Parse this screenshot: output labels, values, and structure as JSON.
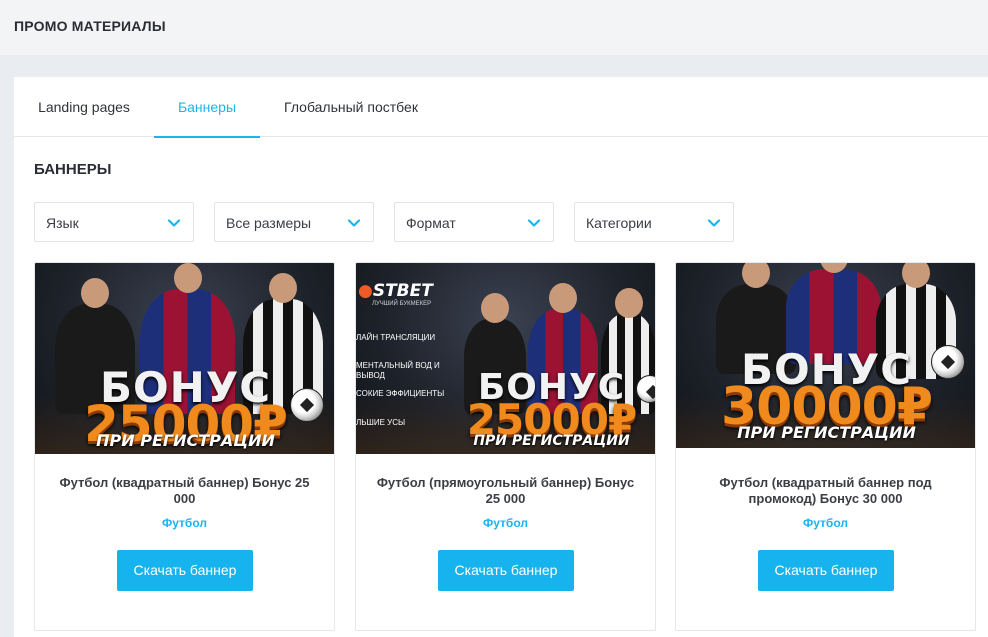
{
  "header": {
    "title": "ПРОМО МАТЕРИАЛЫ"
  },
  "tabs": [
    {
      "label": "Landing pages",
      "active": false
    },
    {
      "label": "Баннеры",
      "active": true
    },
    {
      "label": "Глобальный постбек",
      "active": false
    }
  ],
  "section": {
    "title": "БАННЕРЫ"
  },
  "filters": [
    {
      "value": "Язык",
      "icon": "chevron-down-icon"
    },
    {
      "value": "Все размеры",
      "icon": "chevron-down-icon"
    },
    {
      "value": "Формат",
      "icon": "chevron-down-icon"
    },
    {
      "value": "Категории",
      "icon": "chevron-down-icon"
    }
  ],
  "cards": [
    {
      "title": "Футбол (квадратный баннер) Бонус 25 000",
      "category": "Футбол",
      "button": "Скачать баннер",
      "banner": {
        "line1": "БОНУС",
        "line2": "25000₽",
        "line3": "ПРИ РЕГИСТРАЦИИ"
      }
    },
    {
      "title": "Футбол (прямоугольный баннер) Бонус 25 000",
      "category": "Футбол",
      "button": "Скачать баннер",
      "banner": {
        "logo": "STBET",
        "logo_sub": "ЛУЧШИЙ БУКМЕКЕР",
        "features": [
          "ЛАЙН ТРАНСЛЯЦИИ",
          "МЕНТАЛЬНЫЙ ВОД И ВЫВОД",
          "СОКИЕ ЭФФИЦИЕНТЫ",
          "ЛЬШИЕ УСЫ"
        ],
        "line1": "БОНУС",
        "line2": "25000₽",
        "line3": "ПРИ РЕГИСТРАЦИИ"
      }
    },
    {
      "title": "Футбол (квадратный баннер под промокод) Бонус 30 000",
      "category": "Футбол",
      "button": "Скачать баннер",
      "banner": {
        "line1": "БОНУС",
        "line2": "30000₽",
        "line3": "ПРИ РЕГИСТРАЦИИ"
      }
    }
  ],
  "colors": {
    "accent": "#1cb4ee",
    "button": "#17b3ef",
    "page_bg": "#e9ecf1"
  }
}
